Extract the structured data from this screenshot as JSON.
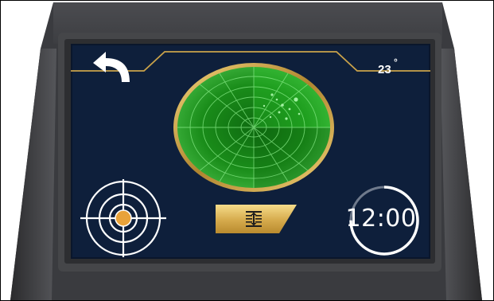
{
  "hud": {
    "back_icon": "back-arrow-icon",
    "temperature": "23",
    "temperature_unit": "°"
  },
  "radar": {
    "icon": "radar-icon"
  },
  "controls": {
    "target_icon": "target-icon",
    "adjust_icon": "vertical-adjust-icon",
    "timer_text": "12:00",
    "timer_progress": 0.75
  },
  "colors": {
    "screen_bg": "#0e1f3b",
    "gold": "#c9a24a",
    "radar_green": "#1f8a1f",
    "target_orange": "#e8a23a"
  }
}
